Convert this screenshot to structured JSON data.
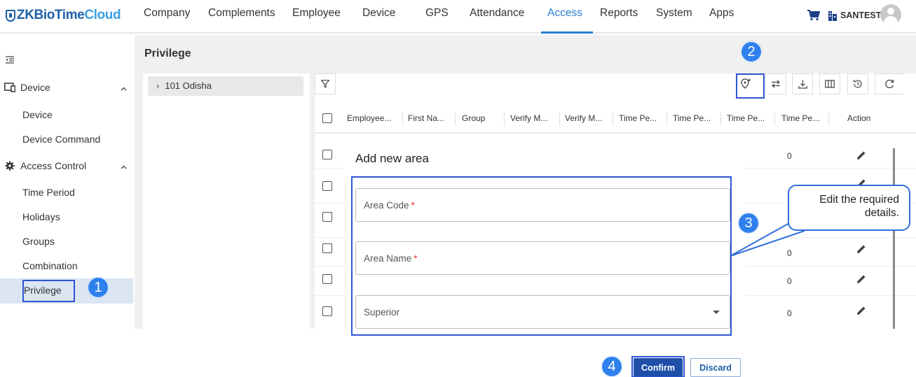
{
  "app": {
    "logo_main": "ZKBioTime",
    "logo_accent": "Cloud"
  },
  "nav": {
    "items": [
      {
        "label": "Company"
      },
      {
        "label": "Complements"
      },
      {
        "label": "Employee"
      },
      {
        "label": "Device"
      },
      {
        "label": "GPS"
      },
      {
        "label": "Attendance"
      },
      {
        "label": "Access"
      },
      {
        "label": "Reports"
      },
      {
        "label": "System"
      },
      {
        "label": "Apps"
      }
    ],
    "active": "Access",
    "org_label": "SANTEST",
    "icons": [
      "cart-icon",
      "organization-icon",
      "user-avatar-icon"
    ]
  },
  "sidebar": {
    "groups": [
      {
        "label": "Device",
        "icon": "device-icon",
        "expanded": true,
        "items": [
          {
            "label": "Device"
          },
          {
            "label": "Device Command"
          }
        ]
      },
      {
        "label": "Access Control",
        "icon": "gear-icon",
        "expanded": true,
        "items": [
          {
            "label": "Time Period"
          },
          {
            "label": "Holidays"
          },
          {
            "label": "Groups"
          },
          {
            "label": "Combination"
          },
          {
            "label": "Privilege"
          }
        ]
      }
    ],
    "selected": "Privilege"
  },
  "page": {
    "title": "Privilege",
    "tree": {
      "node": "101 Odisha"
    },
    "toolbar_icons": [
      "add-area-icon",
      "transfer-icon",
      "download-icon",
      "columns-icon",
      "history-icon",
      "refresh-icon"
    ]
  },
  "table": {
    "headers": [
      "Employee...",
      "First Na...",
      "Group",
      "Verify M...",
      "Verify M...",
      "Time Pe...",
      "Time Pe...",
      "Time Pe...",
      "Time Pe...",
      "Action"
    ],
    "rows": [
      {
        "time_period": "0"
      },
      {
        "time_period": ""
      },
      {
        "time_period": ""
      },
      {
        "time_period": "0"
      },
      {
        "time_period": "0"
      },
      {
        "time_period": "0"
      }
    ]
  },
  "modal": {
    "title": "Add new area",
    "fields": [
      {
        "label": "Area Code",
        "required": true
      },
      {
        "label": "Area Name",
        "required": true
      },
      {
        "label": "Superior",
        "required": false,
        "type": "select"
      }
    ],
    "required_mark": "*",
    "confirm_label": "Confirm",
    "discard_label": "Discard"
  },
  "annotations": {
    "steps": [
      "1",
      "2",
      "3",
      "4"
    ],
    "callout_text": "Edit the required details.",
    "accent_color": "#2f80ed"
  }
}
